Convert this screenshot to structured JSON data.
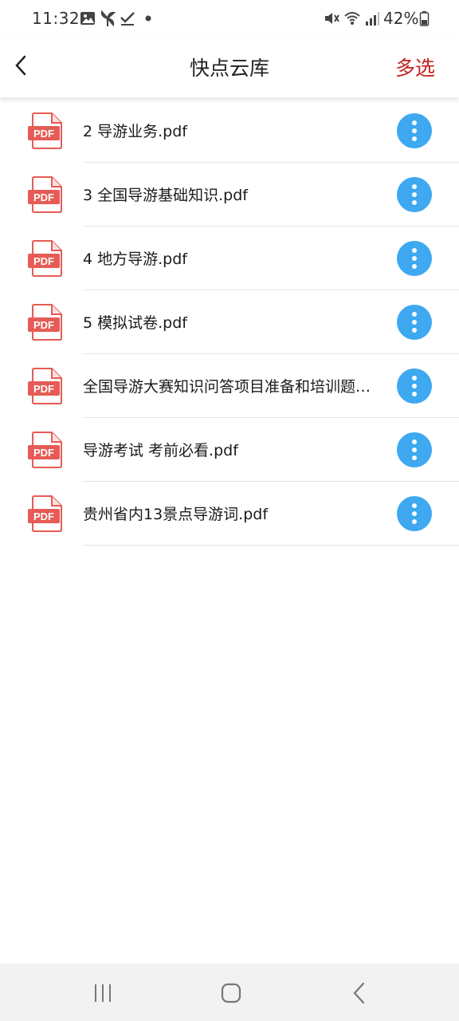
{
  "status_bar": {
    "time": "11:32",
    "battery_percent": "42%",
    "icons": [
      "gallery-icon",
      "pinwheel-icon",
      "check-icon",
      "dot-icon",
      "mute-icon",
      "wifi-icon",
      "signal-icon",
      "battery-icon"
    ]
  },
  "header": {
    "title": "快点云库",
    "multi_select_label": "多选",
    "accent_color": "#c02220"
  },
  "files": [
    {
      "name": "2 导游业务.pdf"
    },
    {
      "name": "3 全国导游基础知识.pdf"
    },
    {
      "name": "4 地方导游.pdf"
    },
    {
      "name": "5 模拟试卷.pdf"
    },
    {
      "name": "全国导游大赛知识问答项目准备和培训题…"
    },
    {
      "name": "导游考试 考前必看.pdf"
    },
    {
      "name": "贵州省内13景点导游词.pdf"
    }
  ],
  "file_icon_label": "PDF",
  "colors": {
    "pdf_icon": "#e65b55",
    "more_button": "#3ea8f0"
  },
  "nav_bar": {
    "buttons": [
      "recent-apps-icon",
      "home-icon",
      "back-icon"
    ]
  }
}
